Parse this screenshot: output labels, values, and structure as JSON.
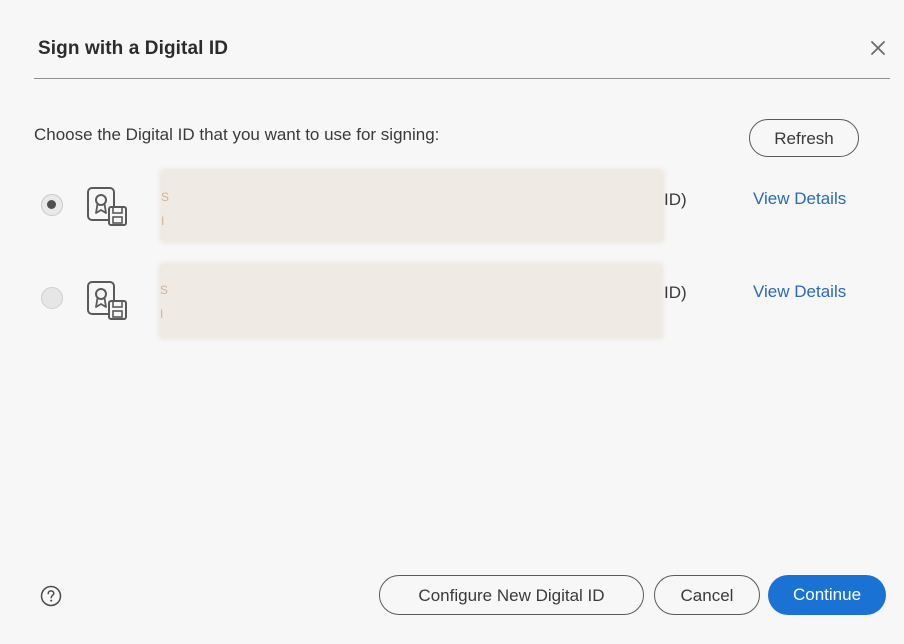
{
  "dialog": {
    "title": "Sign with a Digital ID",
    "prompt": "Choose the Digital ID that you want to use for signing:",
    "refresh_label": "Refresh"
  },
  "ids": [
    {
      "selected": true,
      "name_suffix": "ID)",
      "name_edge": "S",
      "detail_edge": "I",
      "view_details_label": "View Details"
    },
    {
      "selected": false,
      "name_suffix": "ID)",
      "name_edge": "S",
      "detail_edge": "I",
      "view_details_label": "View Details"
    }
  ],
  "footer": {
    "help_icon": "question-circle-icon",
    "configure_label": "Configure New Digital ID",
    "cancel_label": "Cancel",
    "continue_label": "Continue"
  },
  "colors": {
    "accent": "#1a73d4",
    "link": "#2a6ab8",
    "redaction": "#efebe4"
  }
}
